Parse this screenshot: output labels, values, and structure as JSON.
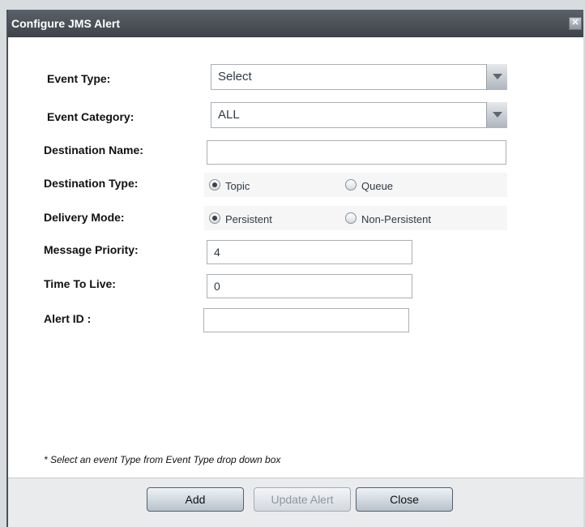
{
  "dialog": {
    "title": "Configure JMS Alert"
  },
  "form": {
    "event_type": {
      "label": "Event Type:",
      "value": "Select"
    },
    "event_category": {
      "label": "Event Category:",
      "value": "ALL"
    },
    "destination_name": {
      "label": "Destination Name:",
      "value": ""
    },
    "destination_type": {
      "label": "Destination Type:",
      "options": [
        "Topic",
        "Queue"
      ],
      "selected": "Topic"
    },
    "delivery_mode": {
      "label": "Delivery Mode:",
      "options": [
        "Persistent",
        "Non-Persistent"
      ],
      "selected": "Persistent"
    },
    "message_priority": {
      "label": "Message Priority:",
      "value": "4"
    },
    "time_to_live": {
      "label": "Time To Live:",
      "value": "0"
    },
    "alert_id": {
      "label": "Alert ID :",
      "value": ""
    }
  },
  "footnote": "* Select an event Type from Event Type drop down box",
  "buttons": {
    "add": "Add",
    "update": "Update Alert",
    "close": "Close"
  }
}
